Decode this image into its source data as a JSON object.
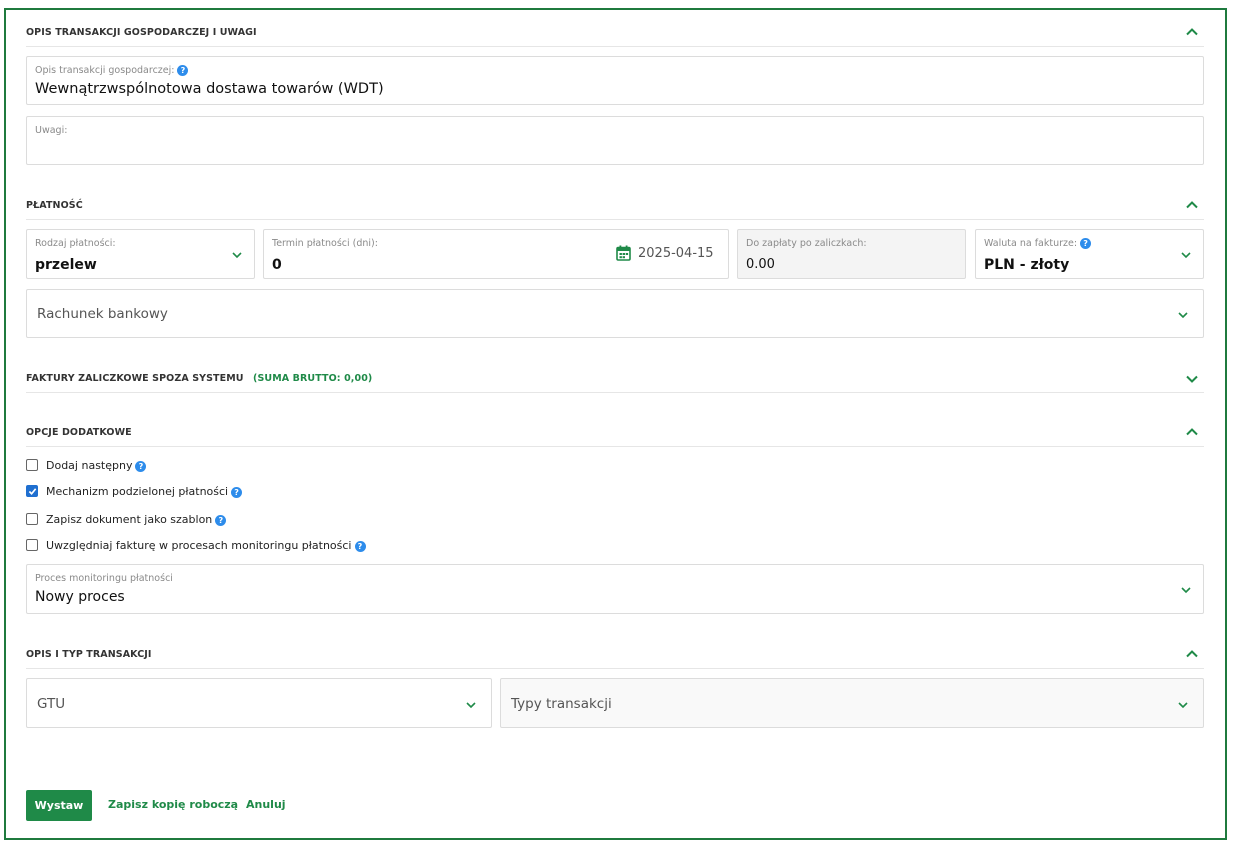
{
  "sections": {
    "opis": {
      "title": "OPIS TRANSAKCJI GOSPODARCZEJ I UWAGI",
      "description_label": "Opis transakcji gospodarczej:",
      "description_value": "Wewnątrzwspólnotowa dostawa towarów  (WDT)",
      "notes_label": "Uwagi:",
      "notes_value": ""
    },
    "platnosc": {
      "title": "PŁATNOŚĆ",
      "payment_type_label": "Rodzaj płatności:",
      "payment_type_value": "przelew",
      "term_label": "Termin płatności (dni):",
      "term_value": "0",
      "due_date": "2025-04-15",
      "to_pay_label": "Do zapłaty po zaliczkach:",
      "to_pay_value": "0.00",
      "currency_label": "Waluta na fakturze:",
      "currency_value": "PLN - złoty",
      "bank_account_label": "Rachunek bankowy"
    },
    "faktury": {
      "title": "FAKTURY ZALICZKOWE SPOZA SYSTEMU",
      "sum": "(SUMA BRUTTO: 0,00)"
    },
    "opcje": {
      "title": "OPCJE DODATKOWE",
      "options": [
        {
          "label": "Dodaj następny",
          "checked": false
        },
        {
          "label": "Mechanizm podzielonej płatności",
          "checked": true
        },
        {
          "label": "Zapisz dokument jako szablon",
          "checked": false
        },
        {
          "label": "Uwzględniaj fakturę w procesach monitoringu płatności",
          "checked": false
        }
      ],
      "process_label": "Proces monitoringu płatności",
      "process_value": "Nowy proces"
    },
    "typ": {
      "title": "OPIS I TYP TRANSAKCJI",
      "gtu_label": "GTU",
      "types_label": "Typy transakcji"
    }
  },
  "actions": {
    "issue": "Wystaw",
    "save_draft": "Zapisz kopię roboczą",
    "cancel": "Anuluj"
  },
  "icons": {
    "help": "?",
    "help_color": "#2d8ceb",
    "accent": "#1f8a48"
  }
}
